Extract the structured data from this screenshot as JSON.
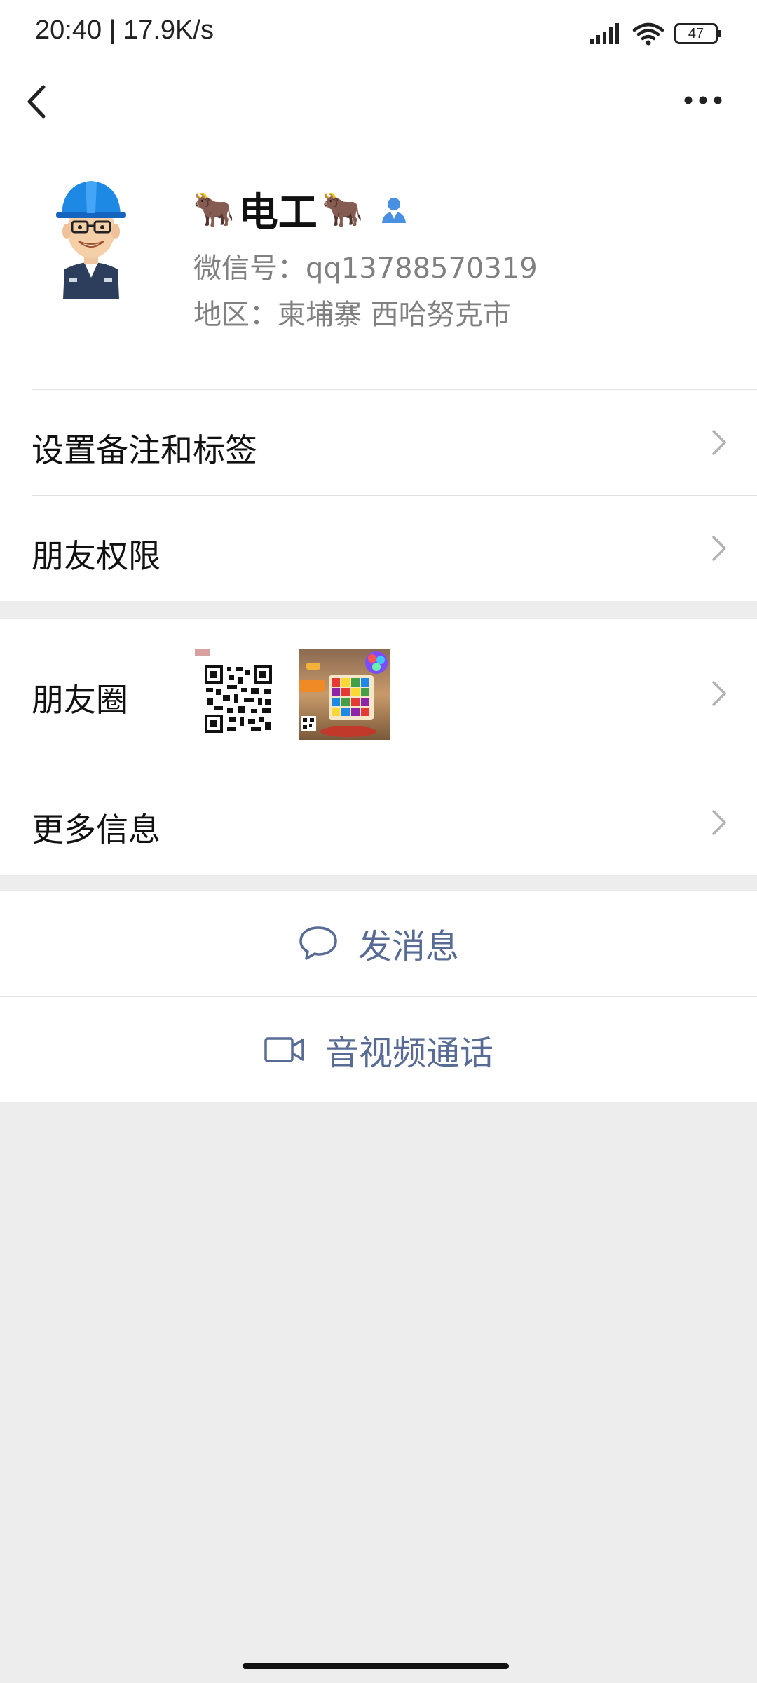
{
  "status_bar": {
    "time": "20:40 | 17.9K/s",
    "battery": "47",
    "icons": [
      "signal-icon",
      "wifi-icon",
      "battery-icon"
    ]
  },
  "nav": {
    "back_icon": "back-chevron-icon",
    "more_icon": "more-icon"
  },
  "profile": {
    "name_prefix_emoji": "🐂",
    "name": "电工",
    "name_suffix_emoji": "🐂",
    "wechat_id": "微信号：qq13788570319",
    "region": "地区：柬埔寨  西哈努克市"
  },
  "menu": {
    "remark_tags": "设置备注和标签",
    "friend_permissions": "朋友权限",
    "moments": "朋友圈",
    "more_info": "更多信息"
  },
  "actions": {
    "send_message": "发消息",
    "video_call": "音视频通话"
  },
  "colors": {
    "link_blue": "#576b95",
    "page_bg": "#ededed",
    "verified_blue": "#4a90e2"
  }
}
